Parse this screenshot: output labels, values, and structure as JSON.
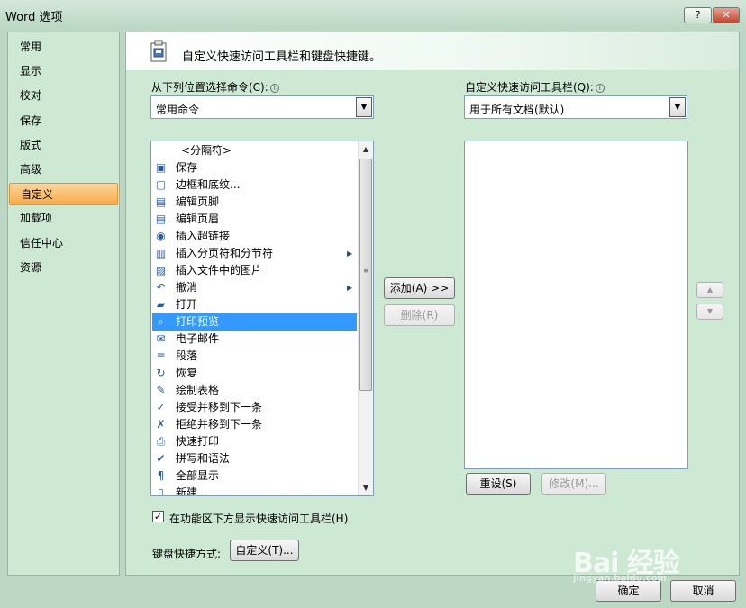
{
  "window": {
    "title": "Word 选项",
    "help_btn": "?",
    "close_btn": "✕"
  },
  "nav": {
    "items": [
      {
        "label": "常用",
        "active": false
      },
      {
        "label": "显示",
        "active": false
      },
      {
        "label": "校对",
        "active": false
      },
      {
        "label": "保存",
        "active": false
      },
      {
        "label": "版式",
        "active": false
      },
      {
        "label": "高级",
        "active": false
      },
      {
        "label": "自定义",
        "active": true
      },
      {
        "label": "加载项",
        "active": false
      },
      {
        "label": "信任中心",
        "active": false
      },
      {
        "label": "资源",
        "active": false
      }
    ]
  },
  "header": {
    "title": "自定义快速访问工具栏和键盘快捷键。"
  },
  "left_pane": {
    "label": "从下列位置选择命令(C):",
    "combo_value": "常用命令",
    "list_items": [
      {
        "label": "<分隔符>",
        "icon": "separator-icon",
        "glyph": "",
        "submenu": false
      },
      {
        "label": "保存",
        "icon": "save-icon",
        "glyph": "▣",
        "submenu": false
      },
      {
        "label": "边框和底纹...",
        "icon": "border-icon",
        "glyph": "▢",
        "submenu": false
      },
      {
        "label": "编辑页脚",
        "icon": "footer-icon",
        "glyph": "▤",
        "submenu": false
      },
      {
        "label": "编辑页眉",
        "icon": "header-icon",
        "glyph": "▤",
        "submenu": false
      },
      {
        "label": "插入超链接",
        "icon": "hyperlink-icon",
        "glyph": "◉",
        "submenu": false
      },
      {
        "label": "插入分页符和分节符",
        "icon": "page-break-icon",
        "glyph": "▥",
        "submenu": true
      },
      {
        "label": "插入文件中的图片",
        "icon": "picture-icon",
        "glyph": "▨",
        "submenu": false
      },
      {
        "label": "撤消",
        "icon": "undo-icon",
        "glyph": "↶",
        "submenu": true
      },
      {
        "label": "打开",
        "icon": "open-folder-icon",
        "glyph": "▰",
        "submenu": false
      },
      {
        "label": "打印预览",
        "icon": "print-preview-icon",
        "glyph": "⌕",
        "submenu": false,
        "selected": true
      },
      {
        "label": "电子邮件",
        "icon": "email-icon",
        "glyph": "✉",
        "submenu": false
      },
      {
        "label": "段落",
        "icon": "paragraph-icon",
        "glyph": "≡",
        "submenu": false
      },
      {
        "label": "恢复",
        "icon": "redo-icon",
        "glyph": "↻",
        "submenu": false
      },
      {
        "label": "绘制表格",
        "icon": "draw-table-icon",
        "glyph": "✎",
        "submenu": false
      },
      {
        "label": "接受并移到下一条",
        "icon": "accept-icon",
        "glyph": "✓",
        "submenu": false
      },
      {
        "label": "拒绝并移到下一条",
        "icon": "reject-icon",
        "glyph": "✗",
        "submenu": false
      },
      {
        "label": "快速打印",
        "icon": "quick-print-icon",
        "glyph": "⎙",
        "submenu": false
      },
      {
        "label": "拼写和语法",
        "icon": "spelling-icon",
        "glyph": "✔",
        "submenu": false
      },
      {
        "label": "全部显示",
        "icon": "show-all-icon",
        "glyph": "¶",
        "submenu": false
      },
      {
        "label": "新建",
        "icon": "new-doc-icon",
        "glyph": "▯",
        "submenu": false
      }
    ]
  },
  "right_pane": {
    "label": "自定义快速访问工具栏(Q):",
    "combo_value": "用于所有文档(默认)",
    "list_items": []
  },
  "buttons": {
    "add": "添加(A) >>",
    "remove": "删除(R)",
    "move_up": "▲",
    "move_down": "▼",
    "reset": "重设(S)",
    "modify": "修改(M)...",
    "customize": "自定义(T)...",
    "ok": "确定",
    "cancel": "取消"
  },
  "options": {
    "show_below_ribbon_label": "在功能区下方显示快速访问工具栏(H)",
    "show_below_ribbon_checked": true,
    "shortcut_label": "键盘快捷方式:"
  },
  "watermark": {
    "main": "Bai 经验",
    "sub": "jingyan.baidu.com"
  },
  "colors": {
    "selection": "#3399ff",
    "active_nav": "#f7ac4a",
    "panel": "#cde8d3"
  }
}
